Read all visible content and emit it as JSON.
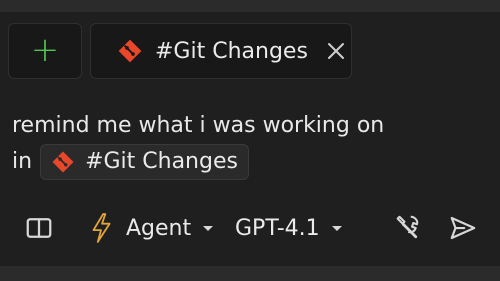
{
  "chat": {
    "add_context_symbol": "+",
    "context_tab": {
      "label": "#Git Changes",
      "icon": "git-icon",
      "close_icon": "close-icon"
    },
    "prompt": {
      "line1": "remind me what i was working on",
      "line2_prefix": "in",
      "chip_label": "#Git Changes"
    },
    "toolbar": {
      "mode_label": "Agent",
      "model_label": "GPT-4.1",
      "icons": [
        "book-icon",
        "bolt-icon",
        "tools-icon",
        "send-icon"
      ]
    }
  },
  "colors": {
    "background": "#1f1f1f",
    "accent_plus": "#52c452",
    "git_orange": "#e8472a",
    "text": "#e6e6e6"
  }
}
